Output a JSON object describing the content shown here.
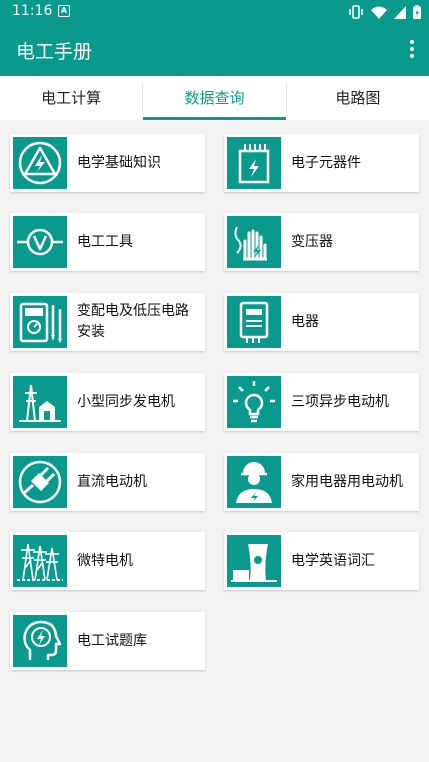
{
  "status_bar": {
    "time": "11:16",
    "notification_glyph": "A",
    "icons": [
      "vibrate-icon",
      "wifi-icon",
      "signal-icon",
      "battery-icon"
    ]
  },
  "app_bar": {
    "title": "电工手册",
    "menu_icon": "more-vert-icon"
  },
  "tabs": [
    {
      "label": "电工计算",
      "active": false
    },
    {
      "label": "数据查询",
      "active": true
    },
    {
      "label": "电路图",
      "active": false
    }
  ],
  "items": [
    {
      "label": "电学基础知识",
      "icon": "lightning-triangle-icon"
    },
    {
      "label": "电子元器件",
      "icon": "electronic-component-icon"
    },
    {
      "label": "电工工具",
      "icon": "voltmeter-icon"
    },
    {
      "label": "变压器",
      "icon": "hand-voltage-icon"
    },
    {
      "label": "变配电及低压电路安装",
      "icon": "multimeter-icon"
    },
    {
      "label": "电器",
      "icon": "electric-meter-icon"
    },
    {
      "label": "小型同步发电机",
      "icon": "power-station-icon"
    },
    {
      "label": "三项异步电动机",
      "icon": "lightbulb-icon"
    },
    {
      "label": "直流电动机",
      "icon": "plug-icon"
    },
    {
      "label": "家用电器用电动机",
      "icon": "electrician-icon"
    },
    {
      "label": "微特电机",
      "icon": "transmission-tower-icon"
    },
    {
      "label": "电学英语词汇",
      "icon": "nuclear-plant-icon"
    },
    {
      "label": "电工试题库",
      "icon": "head-lightning-icon"
    }
  ],
  "colors": {
    "primary": "#0a9a8d",
    "background": "#f2f2f2",
    "card": "#ffffff"
  }
}
